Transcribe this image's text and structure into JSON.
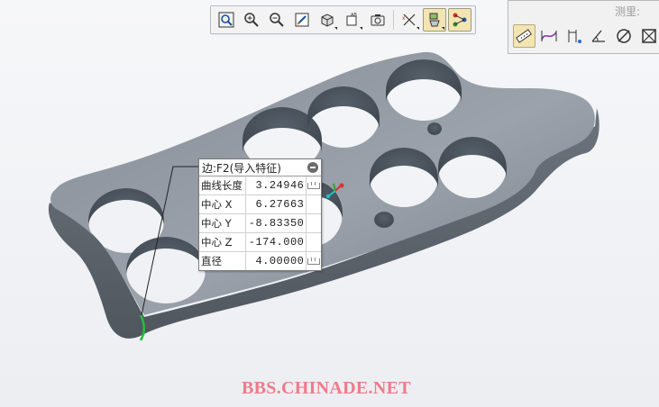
{
  "toolbar": {
    "buttons": [
      {
        "icon": "zoom-fit-icon"
      },
      {
        "icon": "zoom-in-icon"
      },
      {
        "icon": "zoom-out-icon"
      },
      {
        "icon": "repaint-icon"
      },
      {
        "icon": "display-style-icon"
      },
      {
        "icon": "saved-views-icon"
      },
      {
        "icon": "view-manager-icon"
      },
      {
        "icon": "datum-display-icon"
      },
      {
        "icon": "annotation-display-icon",
        "active": true
      },
      {
        "icon": "spin-center-icon",
        "active": true
      }
    ]
  },
  "measure": {
    "title": "测里:",
    "tools": [
      {
        "icon": "measure-length-icon",
        "active": true
      },
      {
        "icon": "measure-curve-icon"
      },
      {
        "icon": "measure-distance-icon"
      },
      {
        "icon": "measure-angle-icon"
      },
      {
        "icon": "measure-diameter-icon"
      },
      {
        "icon": "measure-area-icon"
      }
    ]
  },
  "popup": {
    "title": "边:F2(导入特征)",
    "rows": [
      {
        "label": "曲线长度",
        "value": "3.24946",
        "has_unit": true
      },
      {
        "label": "中心 X",
        "value": "6.27663",
        "has_unit": false
      },
      {
        "label": "中心 Y",
        "value": "-8.83350",
        "has_unit": false
      },
      {
        "label": "中心 Z",
        "value": "-174.000",
        "has_unit": false
      },
      {
        "label": "直径",
        "value": "4.00000",
        "has_unit": true
      }
    ]
  },
  "watermark": "BBS.CHINADE.NET",
  "colors": {
    "part_body": "#8c939c",
    "part_dark": "#5d646c",
    "highlight_edge": "#22c03a",
    "toolbar_active": "#f3e5b1"
  }
}
